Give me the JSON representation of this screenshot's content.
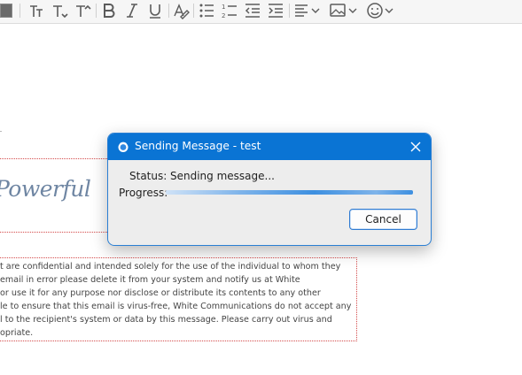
{
  "toolbar": {
    "items": [
      "color-swatch",
      "font-size-icon",
      "font-size-decrease-icon",
      "font-size-increase-icon",
      "bold-icon",
      "italic-icon",
      "underline-icon",
      "clear-formatting-icon",
      "bulleted-list-icon",
      "numbered-list-icon",
      "outdent-icon",
      "indent-icon",
      "align-icon",
      "insert-image-icon",
      "emoji-icon"
    ]
  },
  "editor": {
    "signature_text": "Powerful",
    "disclaimer_lines": [
      "t are confidential and intended solely for the use of the individual to whom they",
      "email in error please delete it from your system and notify us at White",
      " or use it for any purpose nor disclose or distribute its contents to any other",
      "le to ensure that this email is virus-free, White Communications do not accept any",
      "l to the recipient's system or data by this message. Please carry out virus and",
      "opriate."
    ]
  },
  "dialog": {
    "title": "Sending Message - test",
    "status_label": "Status:",
    "status_value": "Sending message...",
    "progress_label": "Progress:",
    "progress_fraction": 1.0,
    "cancel_label": "Cancel",
    "accent_color": "#0a74d4"
  }
}
